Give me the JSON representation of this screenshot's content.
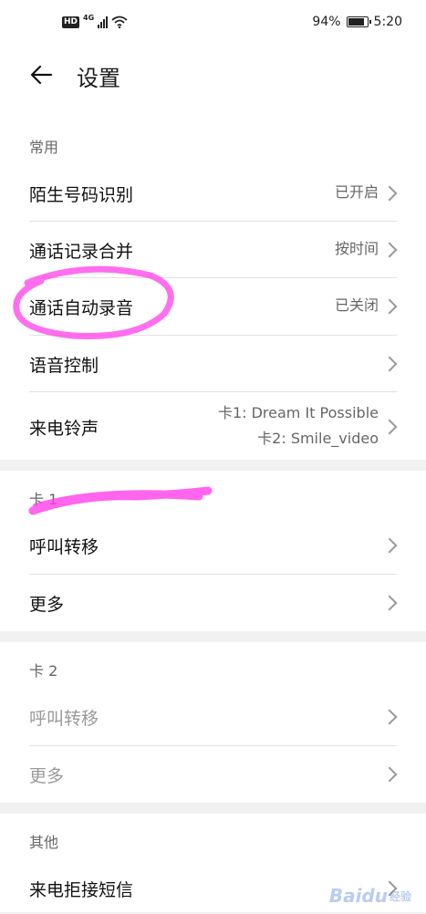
{
  "status_bar": {
    "hd_badge": "HD",
    "network": "4G",
    "battery_percent": "94%",
    "battery_level": 0.94,
    "time": "5:20"
  },
  "header": {
    "title": "设置",
    "back_icon": "arrow-left-icon"
  },
  "sections": {
    "common": {
      "title": "常用",
      "items": [
        {
          "label": "陌生号码识别",
          "value": "已开启"
        },
        {
          "label": "通话记录合并",
          "value": "按时间"
        },
        {
          "label": "通话自动录音",
          "value": "已关闭"
        },
        {
          "label": "语音控制",
          "value": ""
        },
        {
          "label": "来电铃声",
          "value_line1": "卡1: Dream It Possible",
          "value_line2": "卡2: Smile_video"
        }
      ]
    },
    "card1": {
      "title": "卡 1",
      "items": [
        {
          "label": "呼叫转移"
        },
        {
          "label": "更多"
        }
      ]
    },
    "card2": {
      "title": "卡 2",
      "items": [
        {
          "label": "呼叫转移"
        },
        {
          "label": "更多"
        }
      ]
    },
    "other": {
      "title": "其他",
      "items": [
        {
          "label": "来电拒接短信"
        }
      ]
    }
  },
  "highlight_color": "#ff3ee8",
  "watermark": {
    "brand": "Baidu",
    "sub": "经验"
  }
}
